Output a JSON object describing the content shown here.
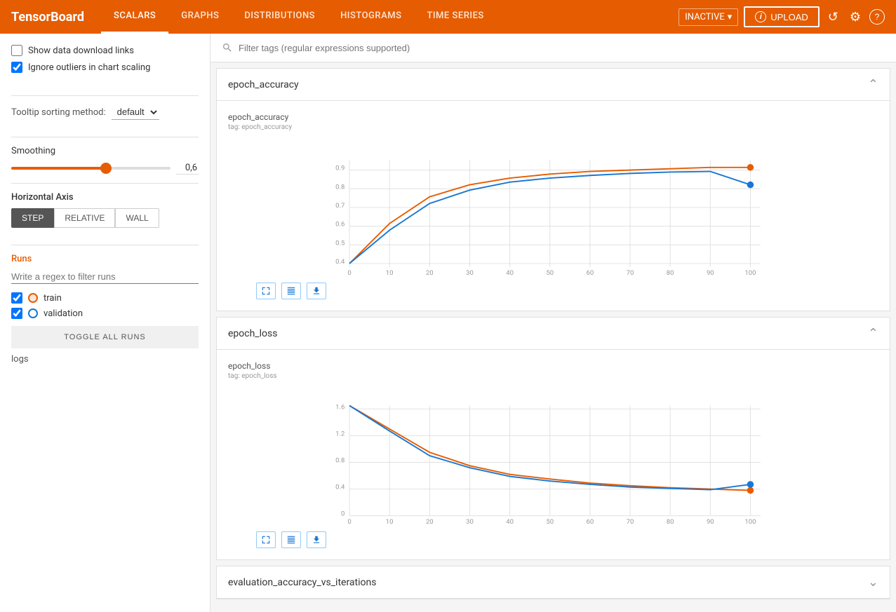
{
  "brand": "TensorBoard",
  "nav": {
    "items": [
      {
        "label": "SCALARS",
        "active": true
      },
      {
        "label": "GRAPHS",
        "active": false
      },
      {
        "label": "DISTRIBUTIONS",
        "active": false
      },
      {
        "label": "HISTOGRAMS",
        "active": false
      },
      {
        "label": "TIME SERIES",
        "active": false
      }
    ],
    "inactive_label": "INACTIVE",
    "upload_label": "UPLOAD",
    "refresh_icon": "↺",
    "settings_icon": "⚙",
    "help_icon": "?"
  },
  "sidebar": {
    "show_data_links_label": "Show data download links",
    "ignore_outliers_label": "Ignore outliers in chart scaling",
    "tooltip_label": "Tooltip sorting method:",
    "tooltip_value": "default",
    "smoothing_label": "Smoothing",
    "smoothing_value": "0,6",
    "horizontal_axis_label": "Horizontal Axis",
    "axis_buttons": [
      {
        "label": "STEP",
        "active": true
      },
      {
        "label": "RELATIVE",
        "active": false
      },
      {
        "label": "WALL",
        "active": false
      }
    ],
    "runs_label": "Runs",
    "runs_filter_placeholder": "Write a regex to filter runs",
    "runs": [
      {
        "label": "train",
        "checked": true,
        "color": "#e65c00"
      },
      {
        "label": "validation",
        "checked": true,
        "color": "#1976d2"
      }
    ],
    "toggle_all_label": "TOGGLE ALL RUNS",
    "logs_label": "logs"
  },
  "filter_placeholder": "Filter tags (regular expressions supported)",
  "charts": [
    {
      "id": "epoch_accuracy",
      "title": "epoch_accuracy",
      "chart_title": "epoch_accuracy",
      "chart_subtitle": "tag: epoch_accuracy",
      "collapsed": false,
      "y_axis": [
        0.4,
        0.5,
        0.6,
        0.7,
        0.8,
        0.9
      ],
      "x_axis": [
        0,
        10,
        20,
        30,
        40,
        50,
        60,
        70,
        80,
        90,
        100
      ]
    },
    {
      "id": "epoch_loss",
      "title": "epoch_loss",
      "chart_title": "epoch_loss",
      "chart_subtitle": "tag: epoch_loss",
      "collapsed": false,
      "y_axis": [
        0,
        0.4,
        0.8,
        1.2,
        1.6
      ],
      "x_axis": [
        0,
        10,
        20,
        30,
        40,
        50,
        60,
        70,
        80,
        90,
        100
      ]
    },
    {
      "id": "evaluation_accuracy_vs_iterations",
      "title": "evaluation_accuracy_vs_iterations",
      "collapsed": true
    }
  ],
  "colors": {
    "orange": "#e65c00",
    "blue": "#1976d2",
    "nav_bg": "#e65c00"
  }
}
